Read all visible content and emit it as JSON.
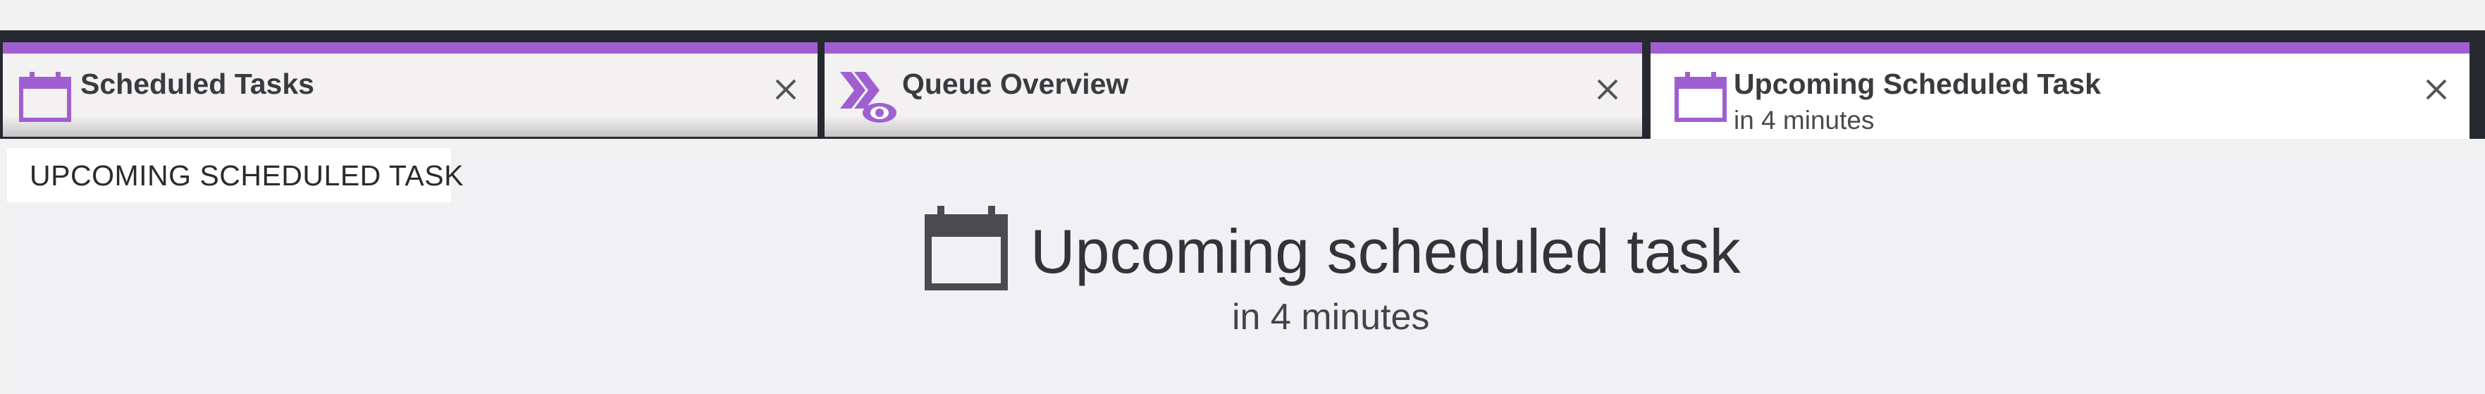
{
  "tabs": [
    {
      "title": "Scheduled Tasks",
      "subtitle": "",
      "icon": "calendar-icon",
      "active": false
    },
    {
      "title": "Queue Overview",
      "subtitle": "",
      "icon": "queue-overview-icon",
      "active": false
    },
    {
      "title": "Upcoming Scheduled Task",
      "subtitle": "in 4 minutes",
      "icon": "calendar-icon",
      "active": true
    }
  ],
  "panel": {
    "label": "UPCOMING SCHEDULED TASK"
  },
  "hero": {
    "title": "Upcoming scheduled task",
    "subtitle": "in 4 minutes",
    "icon": "calendar-icon"
  },
  "colors": {
    "accent": "#a05fd1",
    "frame": "#262a30",
    "text": "#333338"
  }
}
